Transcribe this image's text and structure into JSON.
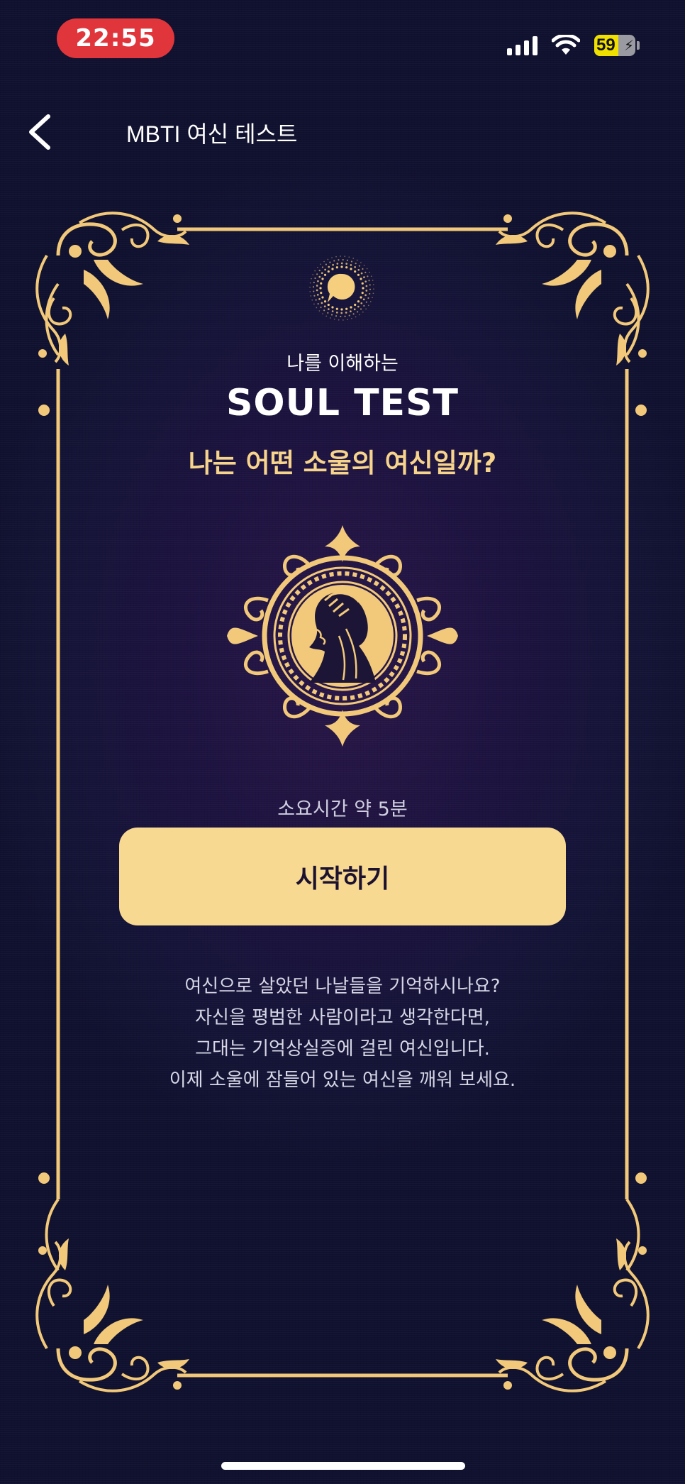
{
  "status_bar": {
    "time": "22:55",
    "battery_level": "59",
    "battery_percent": 59,
    "time_pill_color": "#e0353b",
    "icons": [
      "signal-icon",
      "wifi-icon",
      "battery-icon"
    ]
  },
  "header": {
    "title": "MBTI 여신 테스트",
    "back_icon": "chevron-left-icon"
  },
  "intro": {
    "subtitle": "나를 이해하는",
    "title": "SOUL TEST",
    "question": "나는 어떤 소울의 여신일까?"
  },
  "emblem_icon": "goddess-emblem-icon",
  "logo_icon": "speech-bubble-logo-icon",
  "duration": "소요시간 약 5분",
  "start_button": {
    "label": "시작하기"
  },
  "description": [
    "여신으로 살았던 나날들을 기억하시나요?",
    "자신을 평범한 사람이라고 생각한다면,",
    "그대는 기억상실증에 걸린 여신입니다.",
    "이제 소울에 잠들어 있는 여신을 깨워 보세요."
  ],
  "colors": {
    "background": "#141437",
    "gold": "#f2c97a",
    "accent_text": "#f7d48c",
    "button": "#f8d992"
  }
}
